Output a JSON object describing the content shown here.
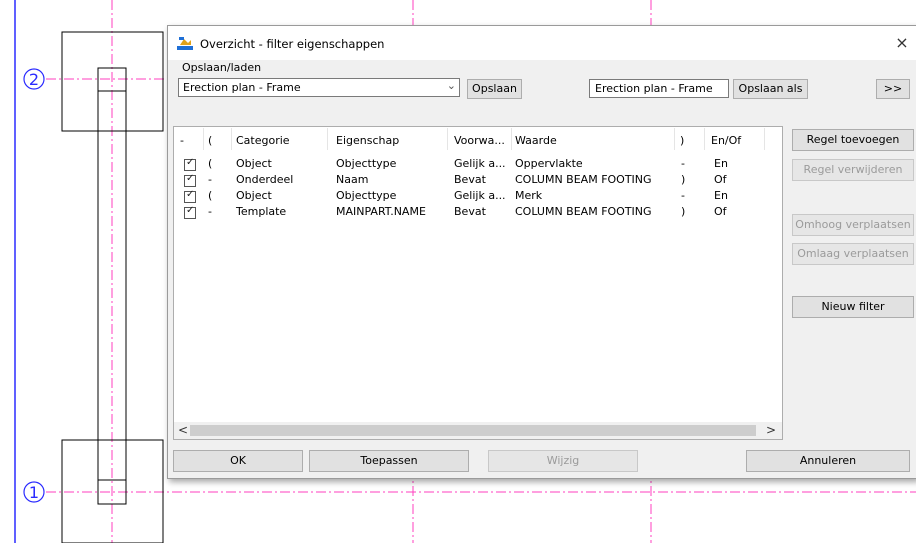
{
  "background": {
    "grid_labels": [
      "2",
      "1"
    ],
    "colors": {
      "grid_line": "#ff3fbf",
      "column_outline": "#000000",
      "bubble": "#2b2bff"
    }
  },
  "dialog": {
    "title": "Overzicht - filter eigenschappen",
    "icon": "filter-app-icon",
    "close_glyph": "×",
    "save_load": {
      "label": "Opslaan/laden",
      "selected": "Erection plan - Frame",
      "save_button": "Opslaan",
      "save_as_value": "Erection plan - Frame",
      "save_as_button": "Opslaan als",
      "expand_button": ">>"
    },
    "table": {
      "columns": [
        "-",
        "(",
        "Categorie",
        "Eigenschap",
        "Voorwa...",
        "Waarde",
        ")",
        "En/Of"
      ],
      "rows": [
        {
          "checked": true,
          "paren_open": "(",
          "category": "Object",
          "property": "Objecttype",
          "condition": "Gelijk a...",
          "value": "Oppervlakte",
          "paren_close": "-",
          "andor": "En"
        },
        {
          "checked": true,
          "paren_open": "-",
          "category": "Onderdeel",
          "property": "Naam",
          "condition": "Bevat",
          "value": "COLUMN BEAM FOOTING",
          "paren_close": ")",
          "andor": "Of"
        },
        {
          "checked": true,
          "paren_open": "(",
          "category": "Object",
          "property": "Objecttype",
          "condition": "Gelijk a...",
          "value": "Merk",
          "paren_close": "-",
          "andor": "En"
        },
        {
          "checked": true,
          "paren_open": "-",
          "category": "Template",
          "property": "MAINPART.NAME",
          "condition": "Bevat",
          "value": "COLUMN BEAM FOOTING",
          "paren_close": ")",
          "andor": "Of"
        }
      ],
      "scroll_left": "<",
      "scroll_right": ">",
      "checkbox_glyph": "✓"
    },
    "side_buttons": {
      "add_rule": "Regel toevoegen",
      "remove_rule": "Regel verwijderen",
      "move_up": "Omhoog verplaatsen",
      "move_down": "Omlaag verplaatsen",
      "new_filter": "Nieuw filter"
    },
    "bottom_buttons": {
      "ok": "OK",
      "apply": "Toepassen",
      "modify": "Wijzig",
      "cancel": "Annuleren"
    }
  }
}
